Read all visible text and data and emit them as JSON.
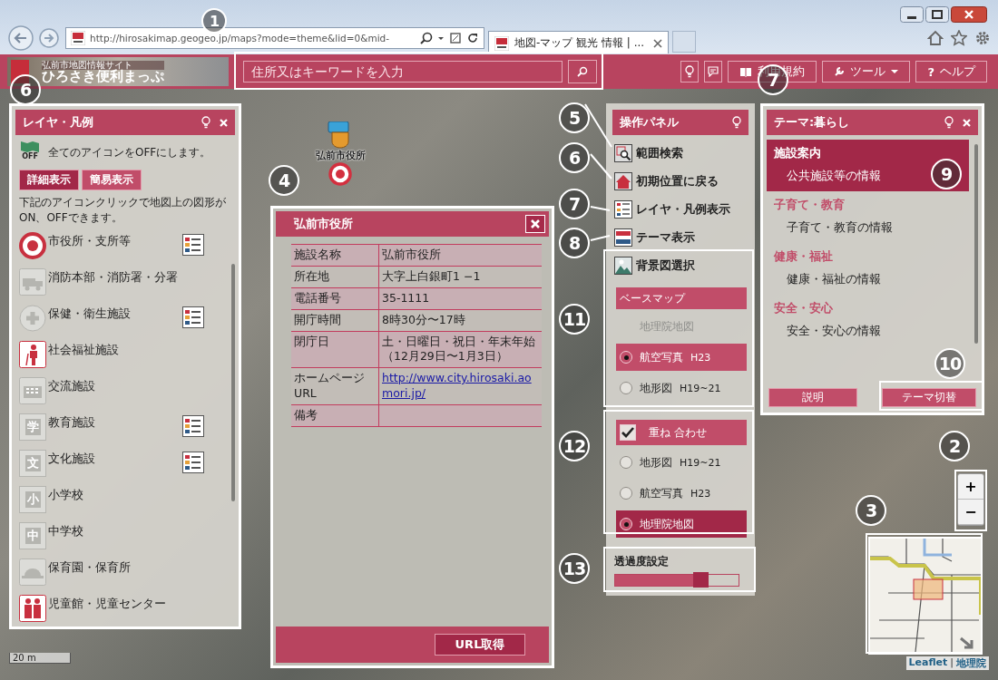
{
  "browser": {
    "url": "http://hirosakimap.geogeo.jp/maps?mode=theme&lid=0&mid-",
    "tab_title": "地図-マップ 観光 情報 | ..."
  },
  "header": {
    "site_name": "弘前市地図情報サイト",
    "logo_text": "ひろさき便利まっぷ",
    "search_placeholder": "住所又はキーワードを入力",
    "buttons": [
      {
        "kind": "book",
        "label": "利用規約",
        "caret": false
      },
      {
        "kind": "wrench",
        "label": "ツール",
        "caret": true
      },
      {
        "kind": "help",
        "glyph": "?",
        "label": "ヘルプ",
        "caret": false
      }
    ]
  },
  "layer_panel": {
    "title": "レイヤ・凡例",
    "all_off_badge": "OFF",
    "all_off_text": "全てのアイコンをOFFにします。",
    "view_buttons": [
      {
        "label": "詳細表示",
        "selected": true
      },
      {
        "label": "簡易表示",
        "selected": false
      }
    ],
    "instruction": "下記のアイコンクリックで地図上の図形がON、OFFできます。",
    "items": [
      {
        "label": "市役所・支所等",
        "kind": "ring",
        "on": true,
        "legend": true
      },
      {
        "label": "消防本部・消防署・分署",
        "kind": "truck",
        "on": false,
        "legend": false
      },
      {
        "label": "保健・衛生施設",
        "kind": "cross",
        "on": false,
        "legend": true
      },
      {
        "label": "社会福祉施設",
        "kind": "person",
        "on": true,
        "legend": false
      },
      {
        "label": "交流施設",
        "kind": "building",
        "on": false,
        "legend": false
      },
      {
        "label": "教育施設",
        "kind": "kanji",
        "glyph": "学",
        "on": false,
        "legend": true
      },
      {
        "label": "文化施設",
        "kind": "kanji",
        "glyph": "文",
        "on": false,
        "legend": true
      },
      {
        "label": "小学校",
        "kind": "kanji",
        "glyph": "小",
        "on": false,
        "legend": false
      },
      {
        "label": "中学校",
        "kind": "kanji",
        "glyph": "中",
        "on": false,
        "legend": false
      },
      {
        "label": "保育園・保育所",
        "kind": "hat",
        "on": false,
        "legend": false
      },
      {
        "label": "児童館・児童センター",
        "kind": "children",
        "on": true,
        "legend": false
      }
    ]
  },
  "marker": {
    "label": "弘前市役所"
  },
  "popup": {
    "title": "弘前市役所",
    "rows": [
      {
        "label": "施設名称",
        "value": "弘前市役所",
        "kind": "text"
      },
      {
        "label": "所在地",
        "value": "大字上白銀町1 −1",
        "kind": "text"
      },
      {
        "label": "電話番号",
        "value": "35-1111",
        "kind": "text"
      },
      {
        "label": "開庁時間",
        "value": "8時30分〜17時",
        "kind": "text"
      },
      {
        "label": "閉庁日",
        "value": "土・日曜日・祝日・年末年始（12月29日〜1月3日）",
        "kind": "text"
      },
      {
        "label": "ホームページURL",
        "value": "http://www.city.hirosaki.aomori.jp/",
        "kind": "link"
      },
      {
        "label": "備考",
        "kind": "text"
      }
    ],
    "button": "URL取得"
  },
  "control_panel": {
    "title": "操作パネル",
    "actions": [
      {
        "label": "範囲検索",
        "kind": "search"
      },
      {
        "label": "初期位置に戻る",
        "kind": "home"
      },
      {
        "label": "レイヤ・凡例表示",
        "kind": "list"
      },
      {
        "label": "テーマ表示",
        "kind": "stripes"
      },
      {
        "label": "背景図選択",
        "kind": "landscape"
      }
    ],
    "base_header": "ベースマップ",
    "base_options": [
      {
        "label": "地理院地図",
        "selected": false,
        "disabled": true
      },
      {
        "label": "航空写真",
        "suffix": "H23",
        "selected": true,
        "disabled": false
      },
      {
        "label": "地形図",
        "suffix": "H19~21",
        "selected": false,
        "disabled": false
      }
    ],
    "overlay": {
      "label": "重ね 合わせ",
      "checked": true
    },
    "overlay_options": [
      {
        "label": "地形図",
        "suffix": "H19~21",
        "selected": false
      },
      {
        "label": "航空写真",
        "suffix": "H23",
        "selected": false
      },
      {
        "label": "地理院地図",
        "selected": true
      }
    ],
    "opacity": {
      "title": "透過度設定",
      "level": 0.7
    }
  },
  "theme_panel": {
    "title": "テーマ:暮らし",
    "sections": [
      {
        "heading": "施設案内",
        "item": "公共施設等の情報",
        "selected": true
      },
      {
        "heading": "子育て・教育",
        "item": "子育て・教育の情報",
        "selected": false
      },
      {
        "heading": "健康・福祉",
        "item": "健康・福祉の情報",
        "selected": false
      },
      {
        "heading": "安全・安心",
        "item": "安全・安心の情報",
        "selected": false
      }
    ],
    "buttons": [
      "説明",
      "テーマ切替"
    ]
  },
  "zoom": {
    "in": "+",
    "out": "−"
  },
  "scale": "20 m",
  "attribution": {
    "links": [
      "Leaflet",
      "地理院"
    ],
    "separator": "|"
  },
  "callouts": [
    "1",
    "6",
    "7",
    "4",
    "5",
    "6",
    "7",
    "8",
    "11",
    "12",
    "13",
    "9",
    "10",
    "2",
    "3"
  ]
}
